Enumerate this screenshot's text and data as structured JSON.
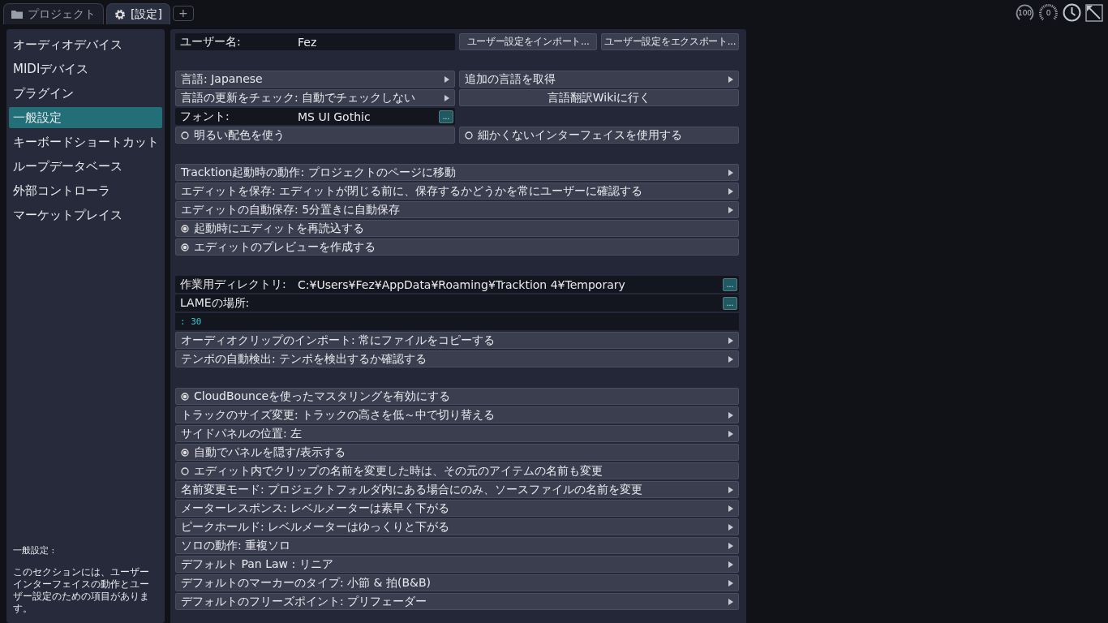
{
  "tabs": [
    {
      "label": "プロジェクト",
      "selected": false
    },
    {
      "label": "[設定]",
      "selected": true
    }
  ],
  "add_tab": "+",
  "meters": [
    {
      "kind": "ring",
      "label": "100"
    },
    {
      "kind": "ticks",
      "label": "0"
    }
  ],
  "sidebar": {
    "items": [
      {
        "label": "オーディオデバイス",
        "selected": false
      },
      {
        "label": "MIDIデバイス",
        "selected": false
      },
      {
        "label": "プラグイン",
        "selected": false
      },
      {
        "label": "一般設定",
        "selected": true
      },
      {
        "label": "キーボードショートカット",
        "selected": false
      },
      {
        "label": "ループデータベース",
        "selected": false
      },
      {
        "label": "外部コントローラ",
        "selected": false
      },
      {
        "label": "マーケットプレイス",
        "selected": false
      }
    ],
    "help_title": "一般設定 :",
    "help_text": "このセクションには、ユーザーインターフェイスの動作とユーザー設定のための項目があります。"
  },
  "sections": [
    {
      "rows": [
        {
          "items": [
            {
              "kind": "field",
              "label": "ユーザー名:",
              "value": "Fez"
            },
            {
              "kind": "button",
              "text": "ユーザー設定をインポート..."
            },
            {
              "kind": "button",
              "text": "ユーザー設定をエクスポート..."
            }
          ]
        }
      ]
    },
    {
      "rows": [
        {
          "items": [
            {
              "kind": "menu",
              "text": "言語: Japanese"
            },
            {
              "kind": "menu",
              "text": "追加の言語を取得"
            }
          ]
        },
        {
          "items": [
            {
              "kind": "menu",
              "text": "言語の更新をチェック: 自動でチェックしない"
            },
            {
              "kind": "button",
              "text": "言語翻訳Wikiに行く"
            }
          ]
        },
        {
          "items": [
            {
              "kind": "field",
              "label": "フォント:",
              "value": "MS UI Gothic",
              "browse": "..."
            },
            {
              "kind": "blank"
            }
          ]
        },
        {
          "items": [
            {
              "kind": "toggle",
              "text": "明るい配色を使う",
              "on": false
            },
            {
              "kind": "toggle",
              "text": "細かくないインターフェイスを使用する",
              "on": false
            }
          ]
        }
      ]
    },
    {
      "rows": [
        {
          "items": [
            {
              "kind": "menu",
              "text": "Tracktion起動時の動作: プロジェクトのページに移動"
            }
          ]
        },
        {
          "items": [
            {
              "kind": "menu",
              "text": "エディットを保存: エディットが閉じる前に、保存するかどうかを常にユーザーに確認する"
            }
          ]
        },
        {
          "items": [
            {
              "kind": "menu",
              "text": "エディットの自動保存: 5分置きに自動保存"
            }
          ]
        },
        {
          "items": [
            {
              "kind": "toggle",
              "text": "起動時にエディットを再読込する",
              "on": true
            }
          ]
        },
        {
          "items": [
            {
              "kind": "toggle",
              "text": "エディットのプレビューを作成する",
              "on": true
            }
          ]
        }
      ]
    },
    {
      "rows": [
        {
          "items": [
            {
              "kind": "field",
              "label": "作業用ディレクトリ:",
              "value": "C:¥Users¥Fez¥AppData¥Roaming¥Tracktion 4¥Temporary",
              "browse": "..."
            }
          ]
        },
        {
          "items": [
            {
              "kind": "field",
              "label": "LAMEの場所:",
              "browse": "..."
            }
          ]
        },
        {
          "items": [
            {
              "kind": "console",
              "text": ": 30"
            }
          ]
        },
        {
          "items": [
            {
              "kind": "menu",
              "text": "オーディオクリップのインポート: 常にファイルをコピーする"
            }
          ]
        },
        {
          "items": [
            {
              "kind": "menu",
              "text": "テンポの自動検出: テンポを検出するか確認する"
            }
          ]
        }
      ]
    },
    {
      "rows": [
        {
          "items": [
            {
              "kind": "toggle",
              "text": "CloudBounceを使ったマスタリングを有効にする",
              "on": true
            }
          ]
        },
        {
          "items": [
            {
              "kind": "menu",
              "text": "トラックのサイズ変更: トラックの高さを低～中で切り替える"
            }
          ]
        },
        {
          "items": [
            {
              "kind": "menu",
              "text": "サイドパネルの位置: 左"
            }
          ]
        },
        {
          "items": [
            {
              "kind": "toggle",
              "text": "自動でパネルを隠す/表示する",
              "on": true
            }
          ]
        },
        {
          "items": [
            {
              "kind": "toggle",
              "text": "エディット内でクリップの名前を変更した時は、その元のアイテムの名前も変更",
              "on": false
            }
          ]
        },
        {
          "items": [
            {
              "kind": "menu",
              "text": "名前変更モード: プロジェクトフォルダ内にある場合にのみ、ソースファイルの名前を変更"
            }
          ]
        },
        {
          "items": [
            {
              "kind": "menu",
              "text": "メーターレスポンス: レベルメーターは素早く下がる"
            }
          ]
        },
        {
          "items": [
            {
              "kind": "menu",
              "text": "ピークホールド: レベルメーターはゆっくりと下がる"
            }
          ]
        },
        {
          "items": [
            {
              "kind": "menu",
              "text": "ソロの動作: 重複ソロ"
            }
          ]
        },
        {
          "items": [
            {
              "kind": "menu",
              "text": "デフォルト Pan Law : リニア"
            }
          ]
        },
        {
          "items": [
            {
              "kind": "menu",
              "text": "デフォルトのマーカーのタイプ: 小節 & 拍(B&B)"
            }
          ]
        },
        {
          "items": [
            {
              "kind": "menu",
              "text": "デフォルトのフリーズポイント: プリフェーダー"
            }
          ]
        }
      ]
    }
  ]
}
